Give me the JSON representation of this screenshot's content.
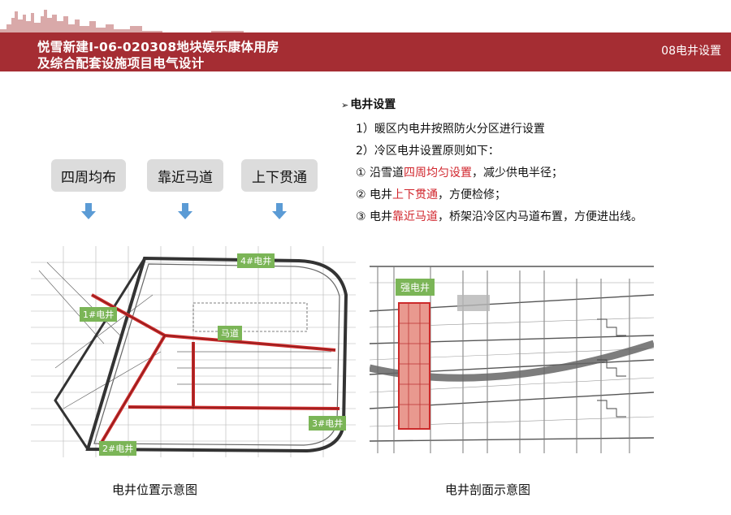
{
  "header": {
    "title_line1": "悦雪新建I-06-020308地块娱乐康体用房",
    "title_line2": "及综合配套设施项目电气设计",
    "section": "08电井设置",
    "colors": {
      "banner": "#a52d33",
      "skyline": "#d9a9a9"
    }
  },
  "tags": [
    {
      "label": "四周均布"
    },
    {
      "label": "靠近马道"
    },
    {
      "label": "上下贯通"
    }
  ],
  "notes": {
    "heading": "电井设置",
    "item1": "1）暖区内电井按照防火分区进行设置",
    "item2": "2）冷区电井设置原则如下：",
    "item3": {
      "prefix": "① 沿雪道",
      "highlight": "四周均匀设置",
      "suffix": "，减少供电半径；"
    },
    "item4": {
      "prefix": "② 电井",
      "highlight": "上下贯通",
      "suffix": "，方便检修；"
    },
    "item5": {
      "prefix": "③ 电井",
      "highlight": "靠近马道",
      "suffix": "，桥架沿冷区内马道布置，方便进出线。"
    },
    "highlight_color": "#d1262d"
  },
  "figure_left": {
    "caption": "电井位置示意图",
    "labels": {
      "shaft1": "1#电井",
      "shaft2": "2#电井",
      "shaft3": "3#电井",
      "shaft4": "4#电井",
      "catwalk": "马道"
    }
  },
  "figure_right": {
    "caption": "电井剖面示意图",
    "labels": {
      "shaft": "强电井"
    }
  }
}
